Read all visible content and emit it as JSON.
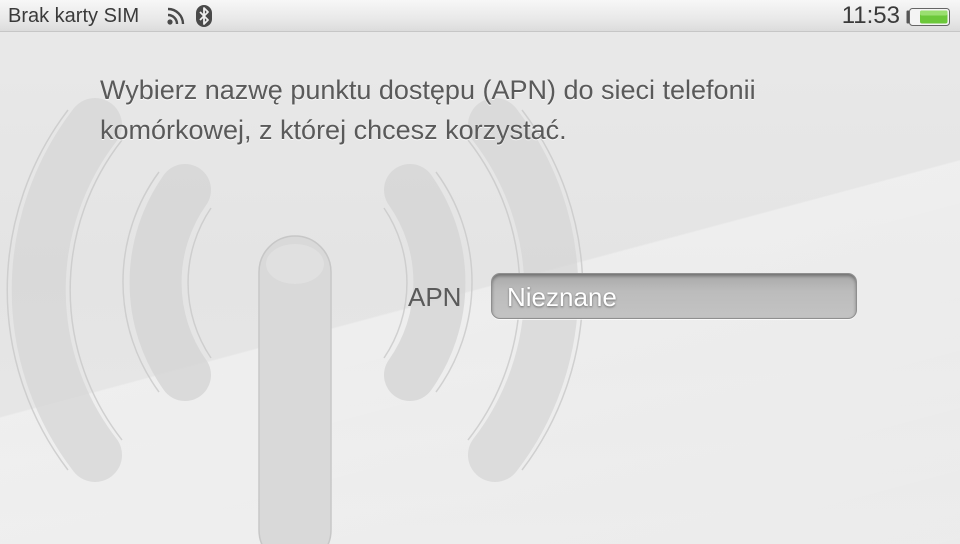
{
  "status_bar": {
    "carrier_text": "Brak karty SIM",
    "signal_icon": "wifi-signal-icon",
    "bluetooth_icon": "bluetooth-icon",
    "time": "11:53",
    "battery_icon": "battery-icon",
    "battery_color": "#6cc83a"
  },
  "background": {
    "illustration": "antenna-tower-icon"
  },
  "main": {
    "instruction": "Wybierz nazwę punktu dostępu (APN) do sieci telefonii komórkowej, z której chcesz korzystać.",
    "apn_label": "APN",
    "apn_value": "Nieznane"
  }
}
